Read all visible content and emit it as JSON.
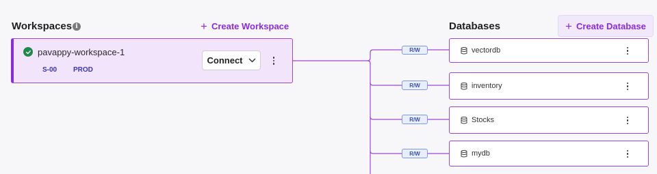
{
  "workspaces": {
    "title": "Workspaces",
    "info_icon": "info-icon",
    "create_label": "Create Workspace",
    "items": [
      {
        "name": "pavappy-workspace-1",
        "status": "running",
        "size": "S-00",
        "environment": "PROD",
        "connect_label": "Connect"
      }
    ]
  },
  "databases": {
    "title": "Databases",
    "create_label": "Create Database",
    "items": [
      {
        "name": "vectordb",
        "access": "R/W"
      },
      {
        "name": "inventory",
        "access": "R/W"
      },
      {
        "name": "Stocks",
        "access": "R/W"
      },
      {
        "name": "mydb",
        "access": "R/W"
      }
    ]
  },
  "colors": {
    "accent": "#8a2be2",
    "status_ok": "#1f8a4c",
    "badge_text": "#3a4fb0"
  }
}
